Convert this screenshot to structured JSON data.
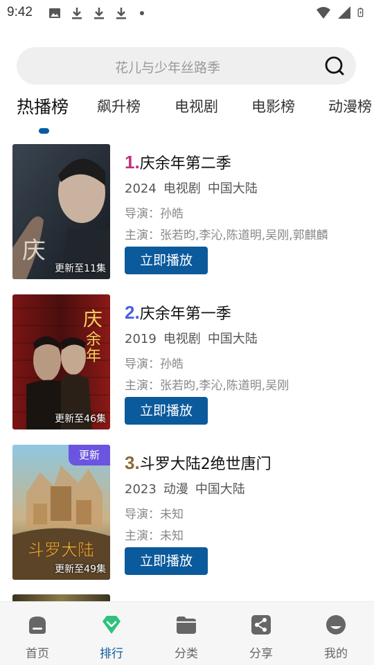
{
  "status_bar": {
    "time": "9:42",
    "left_icons": [
      "image-icon",
      "download-icon",
      "download-icon",
      "download-icon",
      "dot-icon"
    ],
    "right_icons": [
      "wifi-icon",
      "signal-icon",
      "battery-icon"
    ]
  },
  "search": {
    "placeholder": "花儿与少年丝路季",
    "icon": "search-icon"
  },
  "tabs": [
    {
      "label": "热播榜",
      "active": true
    },
    {
      "label": "飙升榜",
      "active": false
    },
    {
      "label": "电视剧",
      "active": false
    },
    {
      "label": "电影榜",
      "active": false
    },
    {
      "label": "动漫榜",
      "active": false
    }
  ],
  "items": [
    {
      "rank": "1.",
      "rank_color": "#c2307a",
      "title": "庆余年第二季",
      "year": "2024",
      "genre": "电视剧",
      "region": "中国大陆",
      "director": "导演：孙皓",
      "cast": "主演：张若昀,李沁,陈道明,吴刚,郭麒麟",
      "update": "更新至11集",
      "badge": "",
      "play_label": "立即播放"
    },
    {
      "rank": "2.",
      "rank_color": "#4a5fe0",
      "title": "庆余年第一季",
      "year": "2019",
      "genre": "电视剧",
      "region": "中国大陆",
      "director": "导演：孙皓",
      "cast": "主演：张若昀,李沁,陈道明,吴刚",
      "update": "更新至46集",
      "badge": "",
      "play_label": "立即播放"
    },
    {
      "rank": "3.",
      "rank_color": "#8a6a3a",
      "title": "斗罗大陆2绝世唐门",
      "year": "2023",
      "genre": "动漫",
      "region": "中国大陆",
      "director": "导演：未知",
      "cast": "主演：未知",
      "update": "更新至49集",
      "badge": "更新",
      "play_label": "立即播放"
    }
  ],
  "bottom_nav": [
    {
      "label": "首页",
      "icon": "home-icon",
      "active": false
    },
    {
      "label": "排行",
      "icon": "ranking-icon",
      "active": true
    },
    {
      "label": "分类",
      "icon": "folder-icon",
      "active": false
    },
    {
      "label": "分享",
      "icon": "share-icon",
      "active": false
    },
    {
      "label": "我的",
      "icon": "profile-icon",
      "active": false
    }
  ],
  "colors": {
    "accent": "#0b5a9c",
    "active_nav_icon": "#2ec27e",
    "badge": "#6b55e0"
  }
}
